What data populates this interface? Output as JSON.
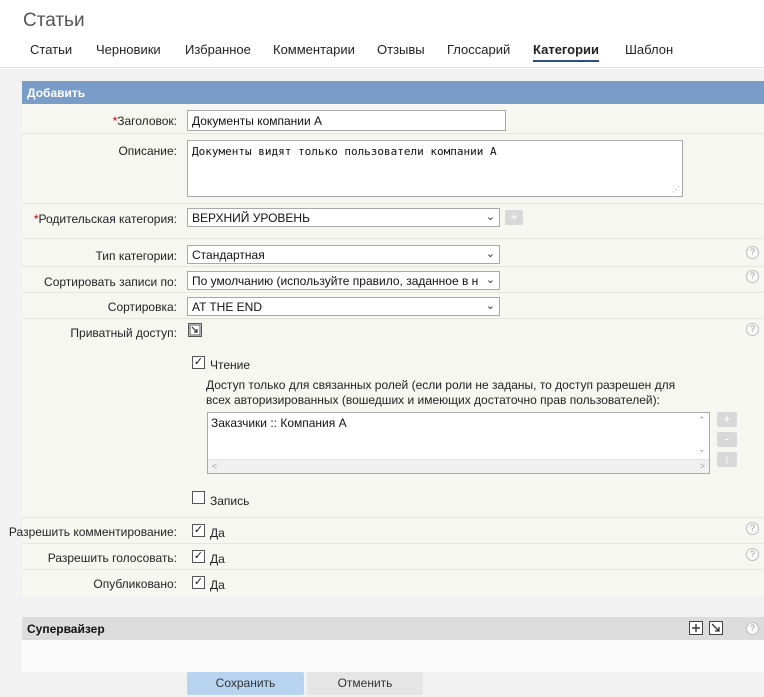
{
  "header": {
    "title": "Статьи",
    "tabs": [
      {
        "label": "Статьи"
      },
      {
        "label": "Черновики"
      },
      {
        "label": "Избранное"
      },
      {
        "label": "Комментарии"
      },
      {
        "label": "Отзывы"
      },
      {
        "label": "Глоссарий"
      },
      {
        "label": "Категории"
      },
      {
        "label": "Шаблон"
      }
    ],
    "active_tab": "Категории"
  },
  "add_section": {
    "title": "Добавить",
    "required_mark": "*",
    "fields": {
      "heading": {
        "label": "Заголовок:",
        "value": "Документы компании А"
      },
      "description": {
        "label": "Описание:",
        "value": "Документы видят только пользователи компании А"
      },
      "parent_category": {
        "label": "Родительская категория:",
        "value": "ВЕРХНИЙ УРОВЕНЬ",
        "add_button": "+"
      },
      "category_type": {
        "label": "Тип категории:",
        "value": "Стандартная"
      },
      "sort_records": {
        "label": "Сортировать записи по:",
        "value": "По умолчанию (используйте правило, заданное в н"
      },
      "sorting": {
        "label": "Сортировка:",
        "value": "AT THE END"
      },
      "private_access": {
        "label": "Приватный доступ:",
        "read": {
          "label": "Чтение",
          "checked": true
        },
        "hint": "Доступ только для связанных ролей (если роли не заданы, то доступ разрешен для всех авторизированных (вошедших и имеющих достаточно прав пользователей):",
        "roles": [
          "Заказчики :: Компания А"
        ],
        "list_buttons": {
          "add": "+",
          "remove": "-",
          "down": "↓"
        },
        "write": {
          "label": "Запись",
          "checked": false
        }
      },
      "allow_comments": {
        "label": "Разрешить комментирование:",
        "option": "Да",
        "checked": true
      },
      "allow_voting": {
        "label": "Разрешить голосовать:",
        "option": "Да",
        "checked": true
      },
      "published": {
        "label": "Опубликовано:",
        "option": "Да",
        "checked": true
      }
    },
    "help_icon": "?"
  },
  "supervisor_section": {
    "title": "Супервайзер",
    "help_icon": "?"
  },
  "actions": {
    "save": "Сохранить",
    "cancel": "Отменить"
  },
  "colors": {
    "section_header": "#7a9cc8",
    "active_tab_underline": "#2a4f86",
    "save_button": "#b8d3ef",
    "required": "#cc0000"
  }
}
